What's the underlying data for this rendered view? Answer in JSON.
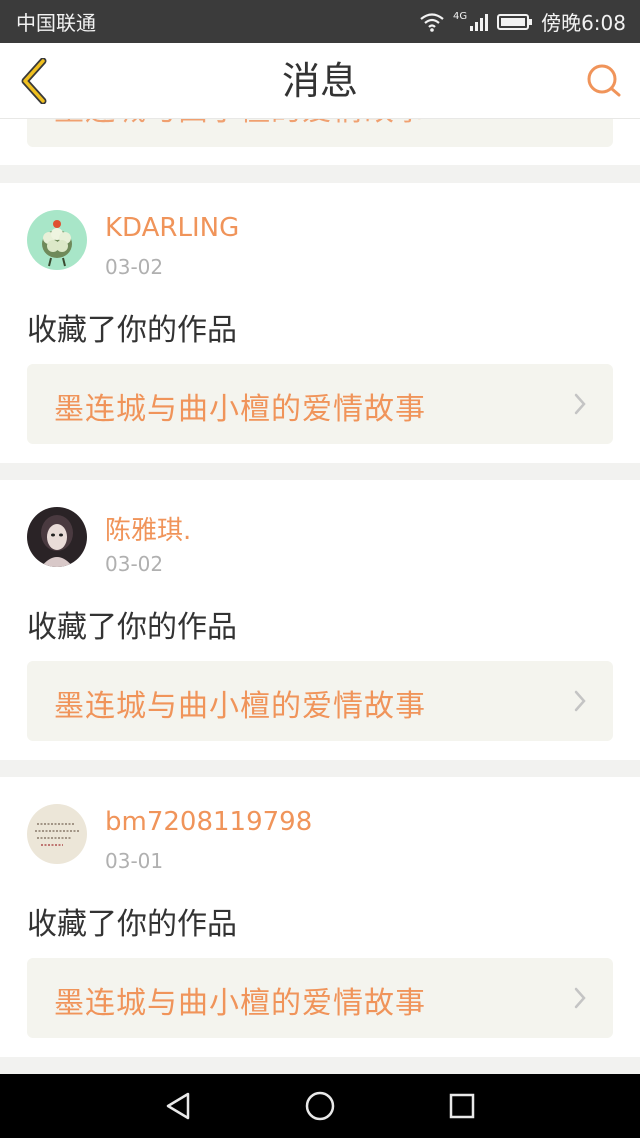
{
  "status_bar": {
    "carrier": "中国联通",
    "network": "4G",
    "time": "傍晚6:08"
  },
  "header": {
    "title": "消息"
  },
  "partial_item": {
    "work_title": "墨连城与曲小檀的爱情故事"
  },
  "messages": [
    {
      "username": "KDARLING",
      "date": "03-02",
      "action": "收藏了你的作品",
      "work_title": "墨连城与曲小檀的爱情故事"
    },
    {
      "username": "陈雅琪.",
      "date": "03-02",
      "action": "收藏了你的作品",
      "work_title": "墨连城与曲小檀的爱情故事"
    },
    {
      "username": "bm7208119798",
      "date": "03-01",
      "action": "收藏了你的作品",
      "work_title": "墨连城与曲小檀的爱情故事"
    }
  ],
  "icons": {
    "back": "back-chevron-icon",
    "search": "search-icon",
    "chevron": "chevron-right-icon"
  },
  "colors": {
    "accent": "#f0945a",
    "card_link_bg": "#f4f4ee",
    "back_icon": "#f0c020"
  }
}
